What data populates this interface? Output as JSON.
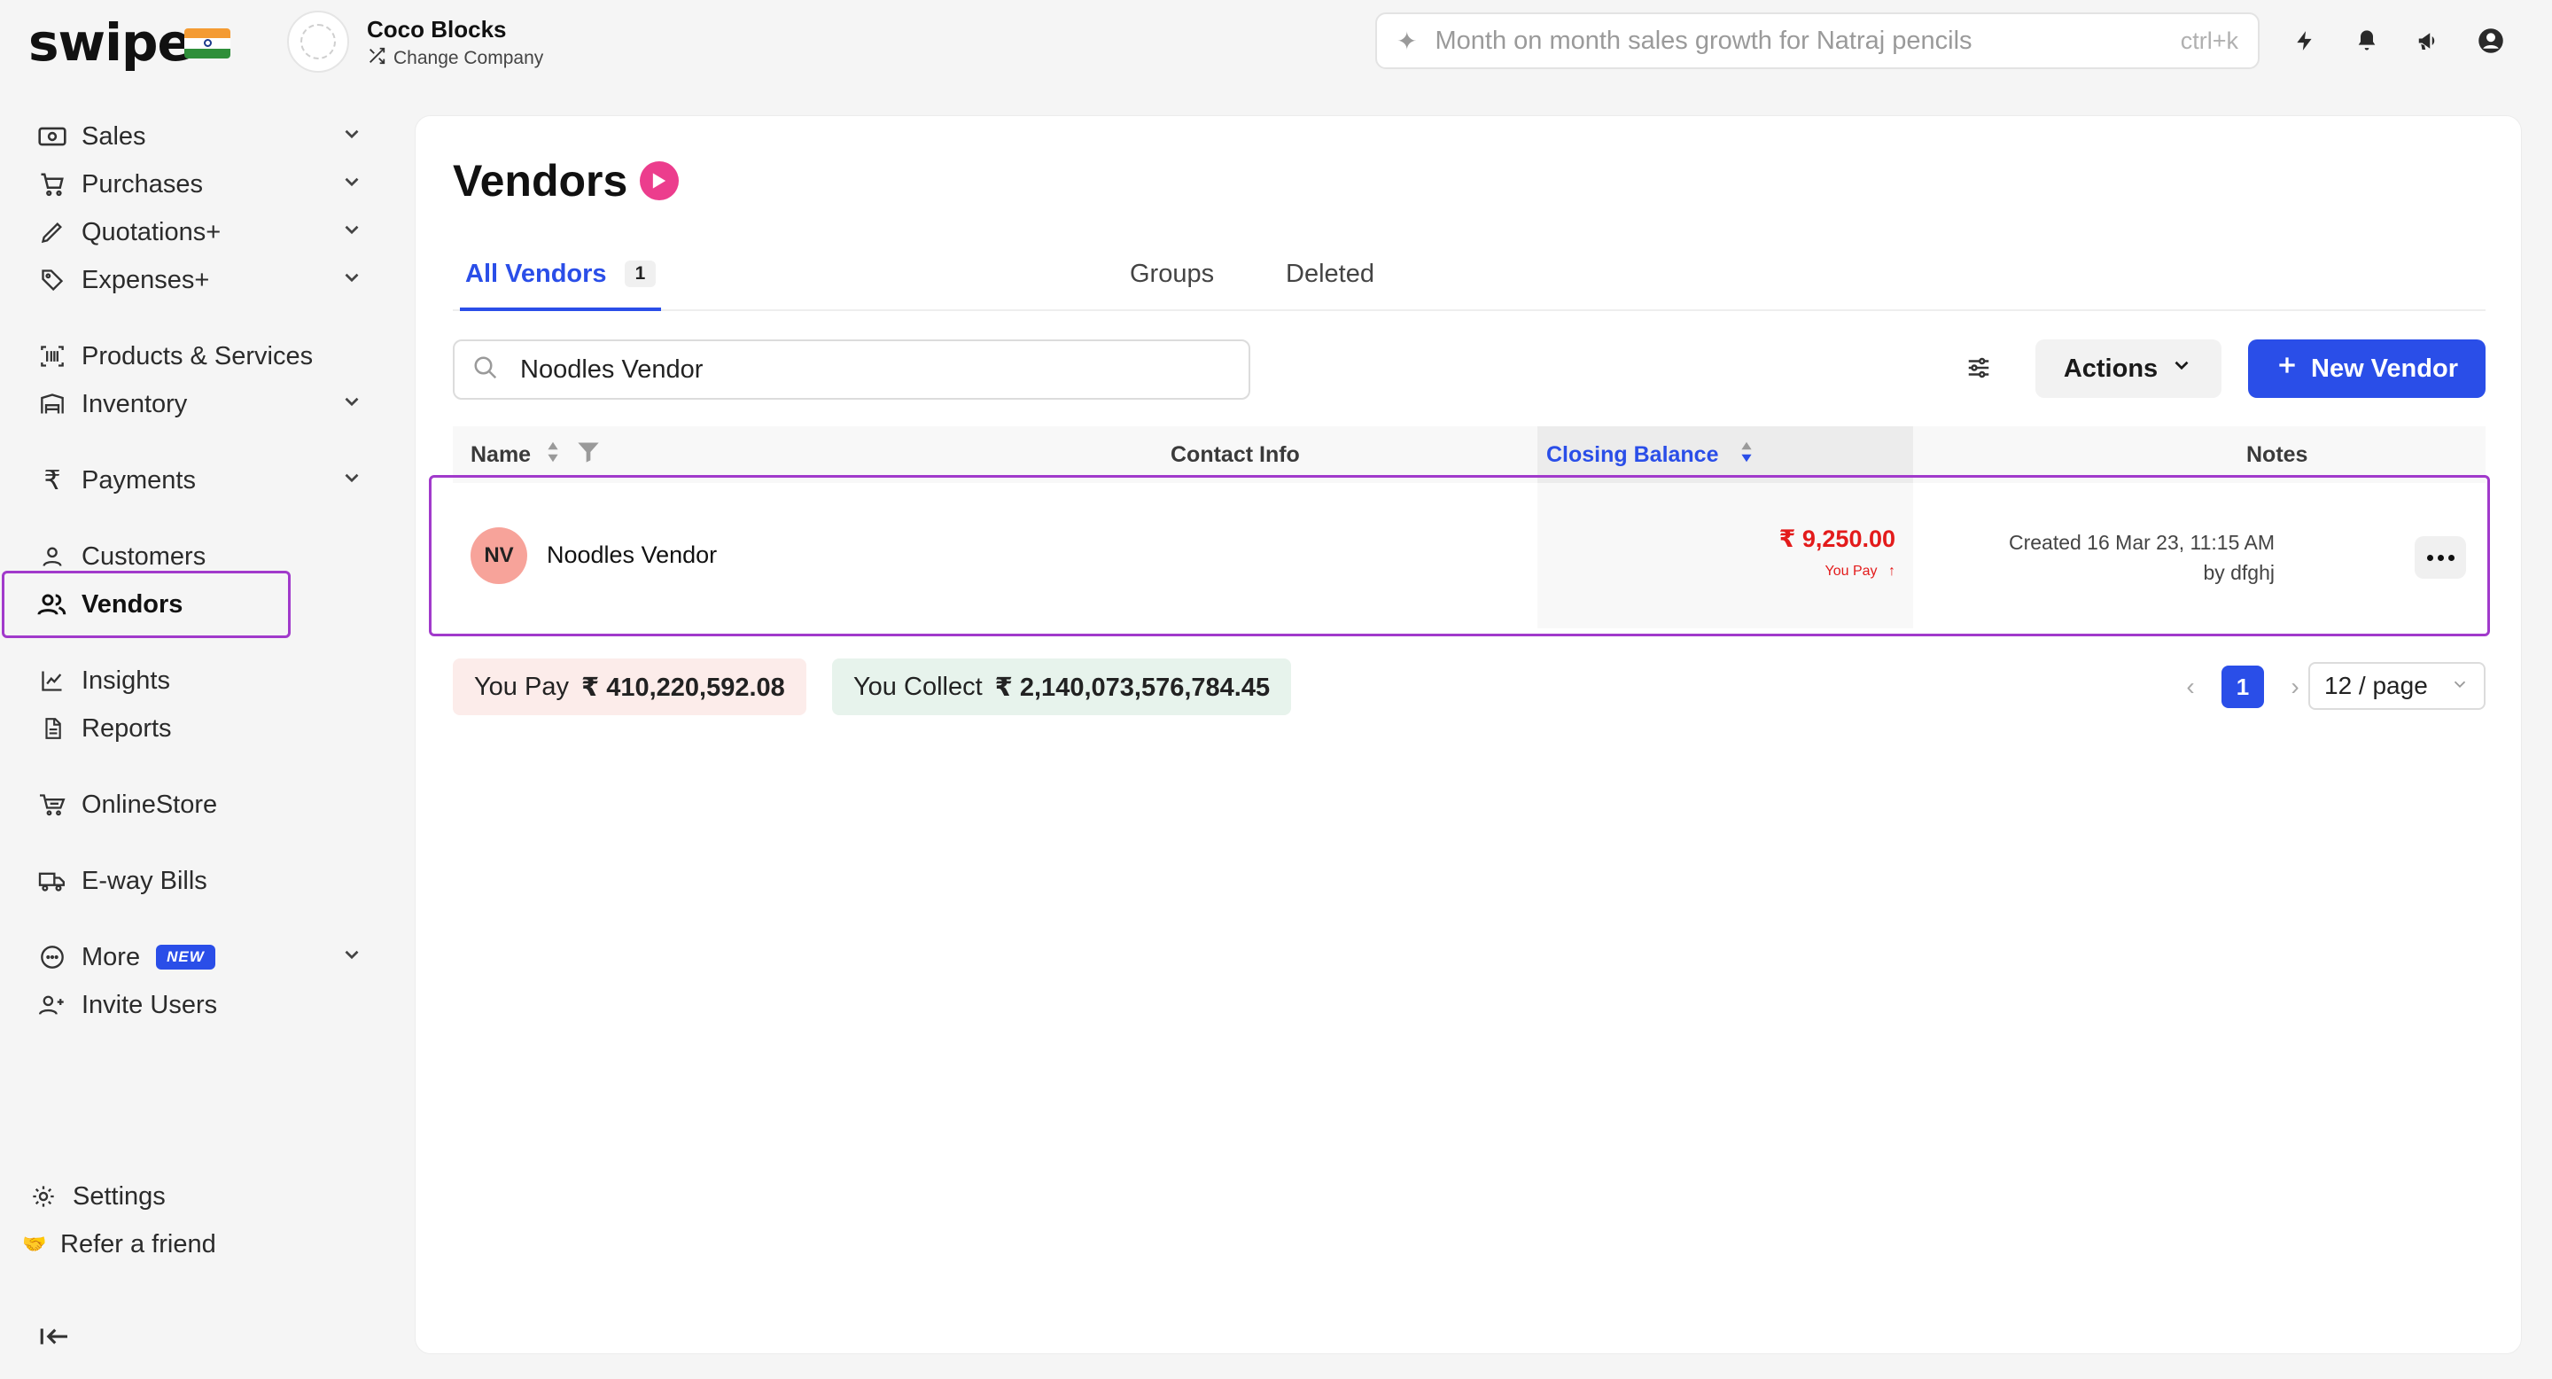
{
  "brand": {
    "logo": "swipe"
  },
  "company": {
    "name": "Coco Blocks",
    "change_label": "Change Company"
  },
  "topsearch": {
    "placeholder": "Month on month sales growth for Natraj pencils",
    "shortcut": "ctrl+k"
  },
  "sidebar": {
    "items": [
      {
        "label": "Sales",
        "icon": "cash-icon"
      },
      {
        "label": "Purchases",
        "icon": "cart-icon"
      },
      {
        "label": "Quotations+",
        "icon": "pencil-icon"
      },
      {
        "label": "Expenses+",
        "icon": "tag-icon"
      },
      {
        "label": "Products & Services",
        "icon": "barcode-icon"
      },
      {
        "label": "Inventory",
        "icon": "warehouse-icon"
      },
      {
        "label": "Payments",
        "icon": "rupee-icon"
      },
      {
        "label": "Customers",
        "icon": "user-icon"
      },
      {
        "label": "Vendors",
        "icon": "users-icon"
      },
      {
        "label": "Insights",
        "icon": "chart-line-icon"
      },
      {
        "label": "Reports",
        "icon": "document-icon"
      },
      {
        "label": "OnlineStore",
        "icon": "store-cart-icon"
      },
      {
        "label": "E-way Bills",
        "icon": "truck-icon"
      },
      {
        "label": "More",
        "icon": "more-circle-icon",
        "badge": "NEW"
      },
      {
        "label": "Invite Users",
        "icon": "user-plus-icon"
      }
    ],
    "settings": "Settings",
    "refer": "Refer a friend"
  },
  "page": {
    "title": "Vendors",
    "tabs": [
      {
        "label": "All Vendors",
        "count": "1"
      },
      {
        "label": "Groups"
      },
      {
        "label": "Deleted"
      }
    ],
    "search_value": "Noodles Vendor",
    "actions_label": "Actions",
    "new_label": "New Vendor"
  },
  "table": {
    "columns": [
      "Name",
      "Contact Info",
      "Closing Balance",
      "Notes"
    ],
    "rows": [
      {
        "initials": "NV",
        "name": "Noodles Vendor",
        "balance": "₹ 9,250.00",
        "balance_note": "You Pay",
        "notes_line1": "Created 16 Mar 23, 11:15 AM",
        "notes_line2": "by dfghj"
      }
    ]
  },
  "summary": {
    "pay_label": "You Pay",
    "pay_value": "₹ 410,220,592.08",
    "collect_label": "You Collect",
    "collect_value": "₹ 2,140,073,576,784.45"
  },
  "pagination": {
    "current": "1",
    "page_size": "12 / page"
  },
  "colors": {
    "accent": "#2a4ee8",
    "highlight": "#a13acb",
    "negative": "#e31b1b",
    "play": "#ec3d8d"
  }
}
